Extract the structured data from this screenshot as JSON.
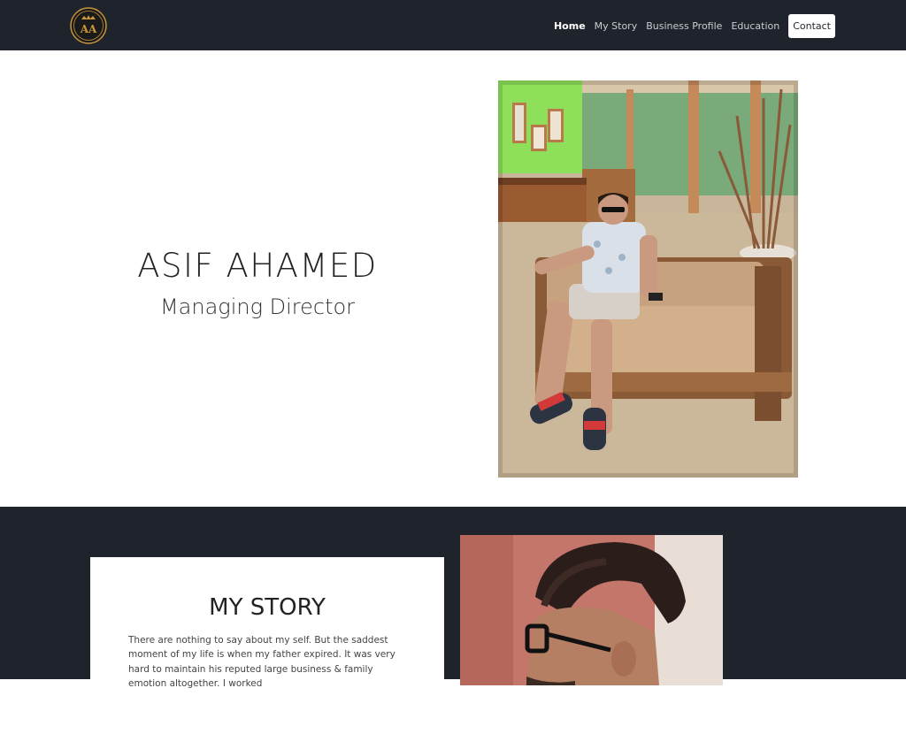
{
  "nav": {
    "logo_letters": "AA",
    "links": [
      "Home",
      "My Story",
      "Business Profile",
      "Education"
    ],
    "contact": "Contact"
  },
  "hero": {
    "name": "ASIF AHAMED",
    "role": "Managing Director"
  },
  "story": {
    "title": "MY STORY",
    "text": "There are nothing to say about my self. But the saddest moment of my life is when my father expired. It was very hard to maintain his reputed large business & family emotion altogether. I worked"
  },
  "colors": {
    "nav_bg": "#1f232b",
    "accent_gold": "#c8953a"
  }
}
